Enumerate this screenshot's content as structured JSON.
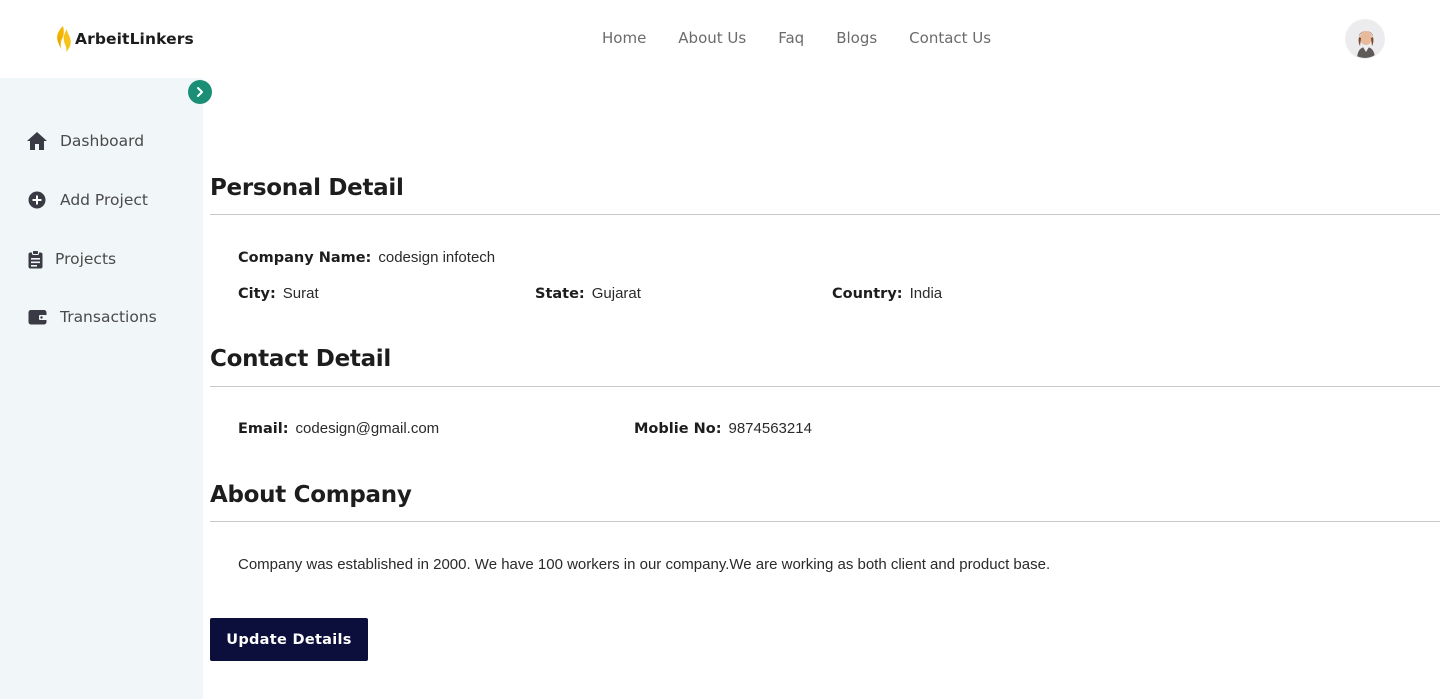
{
  "brand": {
    "name": "ArbeitLinkers",
    "accent": "#f4b400"
  },
  "nav": {
    "items": [
      "Home",
      "About Us",
      "Faq",
      "Blogs",
      "Contact Us"
    ]
  },
  "avatar": {
    "icon": "user-avatar-photo"
  },
  "sidebar": {
    "toggle_icon": "chevron-right-icon",
    "toggle_color": "#1b8f76",
    "items": [
      {
        "label": "Dashboard",
        "icon": "home-icon"
      },
      {
        "label": "Add Project",
        "icon": "plus-circle-icon"
      },
      {
        "label": "Projects",
        "icon": "clipboard-icon"
      },
      {
        "label": "Transactions",
        "icon": "wallet-icon"
      }
    ]
  },
  "personal": {
    "title": "Personal Detail",
    "company_label": "Company Name:",
    "company_value": "codesign infotech",
    "city_label": "City:",
    "city_value": "Surat",
    "state_label": "State:",
    "state_value": "Gujarat",
    "country_label": "Country:",
    "country_value": "India"
  },
  "contact": {
    "title": "Contact Detail",
    "email_label": "Email:",
    "email_value": "codesign@gmail.com",
    "mobile_label": "Moblie No:",
    "mobile_value": "9874563214"
  },
  "about": {
    "title": "About Company",
    "text": "Company was established in 2000. We have 100 workers in our company.We are working as both client and product base."
  },
  "actions": {
    "update_label": "Update Details",
    "button_color": "#0c0e3c"
  }
}
